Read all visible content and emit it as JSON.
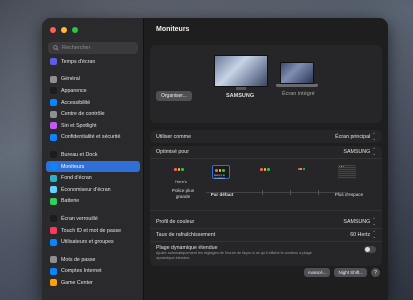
{
  "window": {
    "title": "Moniteurs"
  },
  "sidebar": {
    "search_placeholder": "Rechercher",
    "items": [
      {
        "label": "Temps d'écran",
        "icon": "hourglass-icon",
        "color": "#5e5ce6"
      },
      {
        "label": "Général",
        "icon": "gear-icon",
        "color": "#8e8e93"
      },
      {
        "label": "Apparence",
        "icon": "appearance-icon",
        "color": "#1c1c1e"
      },
      {
        "label": "Accessibilité",
        "icon": "accessibility-icon",
        "color": "#0a84ff"
      },
      {
        "label": "Centre de contrôle",
        "icon": "control-center-icon",
        "color": "#8e8e93"
      },
      {
        "label": "Siri et Spotlight",
        "icon": "siri-icon",
        "color": "#bf5af2"
      },
      {
        "label": "Confidentialité et sécurité",
        "icon": "hand-icon",
        "color": "#0a84ff"
      },
      {
        "label": "Bureau et Dock",
        "icon": "dock-icon",
        "color": "#1c1c1e"
      },
      {
        "label": "Moniteurs",
        "icon": "display-icon",
        "color": "#0a84ff",
        "selected": true
      },
      {
        "label": "Fond d'écran",
        "icon": "wallpaper-icon",
        "color": "#30b0c7"
      },
      {
        "label": "Économiseur d'écran",
        "icon": "screensaver-icon",
        "color": "#64d2ff"
      },
      {
        "label": "Batterie",
        "icon": "battery-icon",
        "color": "#30d158"
      },
      {
        "label": "Écran verrouillé",
        "icon": "lock-icon",
        "color": "#1c1c1e"
      },
      {
        "label": "Touch ID et mot de passe",
        "icon": "fingerprint-icon",
        "color": "#ff375f"
      },
      {
        "label": "Utilisateurs et groupes",
        "icon": "users-icon",
        "color": "#0a84ff"
      },
      {
        "label": "Mots de passe",
        "icon": "key-icon",
        "color": "#8e8e93"
      },
      {
        "label": "Comptes Internet",
        "icon": "at-icon",
        "color": "#0a84ff"
      },
      {
        "label": "Game Center",
        "icon": "game-center-icon",
        "color": "#ff9f0a"
      }
    ]
  },
  "arrangement": {
    "organize_label": "Organiser...",
    "displays": [
      {
        "name": "SAMSUNG"
      },
      {
        "name": "Écran intégré"
      }
    ]
  },
  "settings": {
    "use_as": {
      "label": "Utiliser comme",
      "value": "Écran principal"
    },
    "optimize_for": {
      "label": "Optimisé pour",
      "value": "SAMSUNG"
    },
    "resolution": {
      "options": [
        {
          "thumb_text": "Here's",
          "caption": "Police plus\ngrande"
        },
        {
          "thumb_text": "Here's to\ntroubled",
          "caption": "Par défaut",
          "selected": true
        },
        {
          "thumb_text": "",
          "caption": ""
        },
        {
          "thumb_text": "",
          "caption": ""
        },
        {
          "thumb_text": "",
          "caption": "Plus d'espace"
        }
      ]
    },
    "color_profile": {
      "label": "Profil de couleur",
      "value": "SAMSUNG"
    },
    "refresh_rate": {
      "label": "Taux de rafraîchissement",
      "value": "60 Hertz"
    },
    "dynamic_range": {
      "label": "Plage dynamique étendue",
      "description": "Ajuste automatiquement les réglages de l'écran de façon à ce qu'il affiche le contenu à plage dynamique étendue."
    }
  },
  "footer": {
    "advanced_label": "Avancé...",
    "night_shift_label": "Night Shift...",
    "help_label": "?"
  }
}
